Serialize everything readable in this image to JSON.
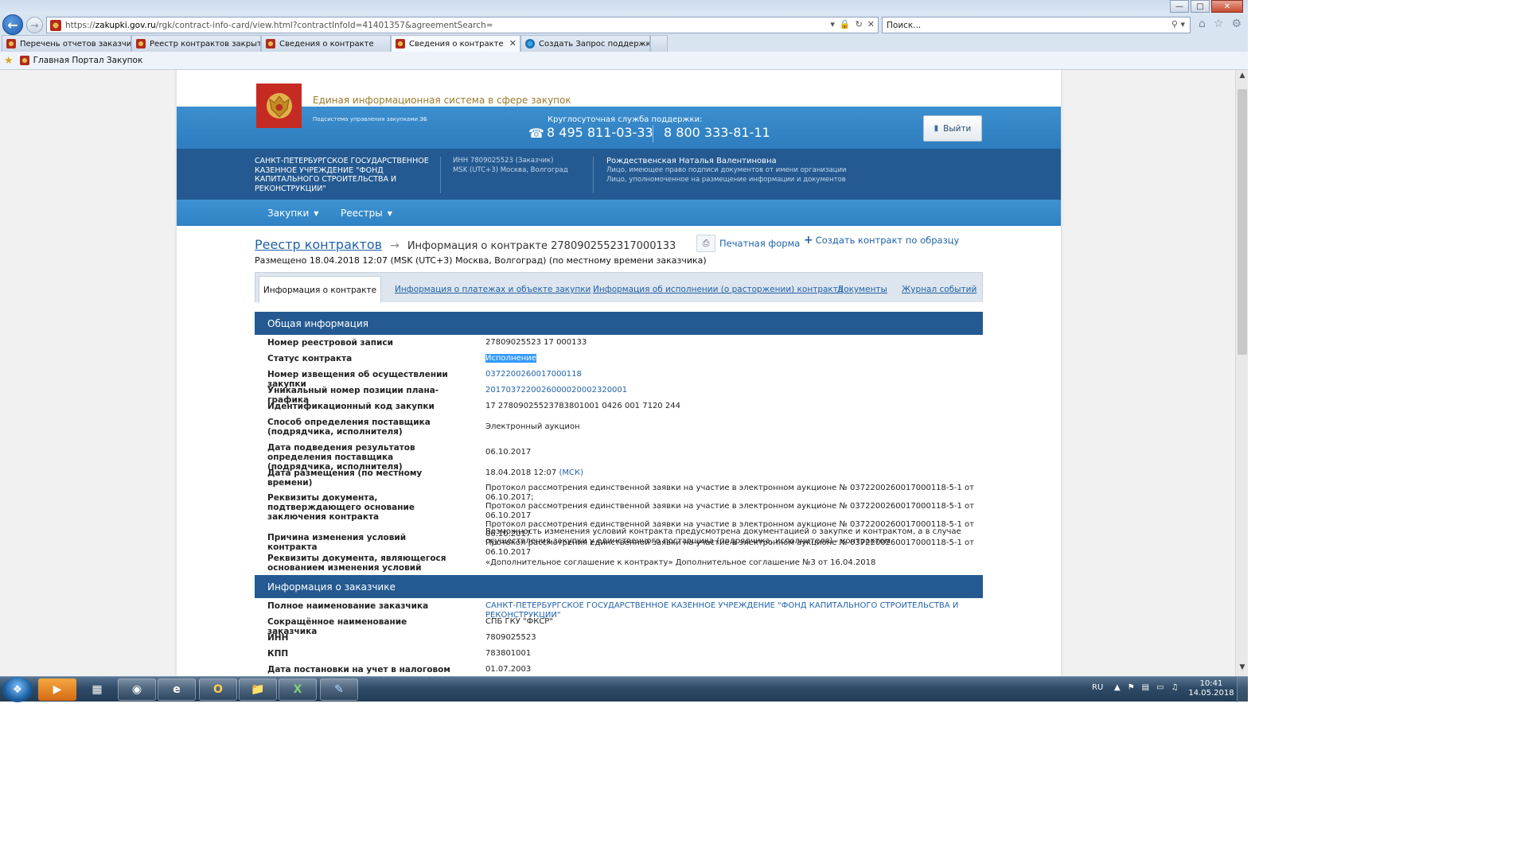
{
  "browser": {
    "url_prefix": "https://",
    "url_domain": "zakupki.gov.ru",
    "url_path": "/rgk/contract-info-card/view.html?contractInfoId=41401357&agreementSearch=",
    "search_placeholder": "Поиск...",
    "tabs": [
      {
        "label": "Перечень отчетов заказчика"
      },
      {
        "label": "Реестр контрактов закрытой ..."
      },
      {
        "label": "Сведения о контракте"
      },
      {
        "label": "Сведения о контракте"
      },
      {
        "label": "Создать Запрос поддержки - ..."
      }
    ],
    "favorites": [
      {
        "label": "Главная Портал Закупок"
      }
    ]
  },
  "header": {
    "site_title": "Единая информационная система в сфере закупок",
    "subsystem": "Подсистема управления закупками ЭБ",
    "support_label": "Круглосуточная служба поддержки:",
    "phone1": "8 495 811-03-33",
    "phone2": "8 800 333-81-11",
    "logout": "Выйти"
  },
  "org": {
    "name": "Санкт-Петербургское государственное казенное учреждение \"Фонд капитального строительства и реконструкции\"",
    "inn_line": "ИНН 7809025523 (Заказчик)",
    "tz_line": "MSK (UTC+3) Москва, Волгоград",
    "user_name": "Рождественская Наталья Валентиновна",
    "role1": "Лицо, имеющее право подписи документов от имени организации",
    "role2": "Лицо, уполномоченное на размещение информации и документов"
  },
  "menu": [
    "Закупки",
    "Реестры"
  ],
  "breadcrumb": {
    "registry": "Реестр контрактов",
    "current": "Информация о контракте 2780902552317000133"
  },
  "actions": {
    "print": "Печатная форма",
    "create": "Создать контракт по образцу"
  },
  "posted": "Размещено 18.04.2018 12:07 (MSK (UTC+3) Москва, Волгоград) (по местному времени заказчика)",
  "content_tabs": {
    "active": "Информация о контракте",
    "others": [
      "Информация о платежах и объекте закупки",
      "Информация об исполнении (о расторжении) контракта",
      "Документы",
      "Журнал событий"
    ]
  },
  "general": {
    "title": "Общая информация",
    "rows": [
      {
        "label": "Номер реестровой записи",
        "value": "27809025523 17 000133"
      },
      {
        "label": "Статус контракта",
        "value": "Исполнение"
      },
      {
        "label": "Номер извещения об осуществлении закупки",
        "value": "0372200260017000118"
      },
      {
        "label": "Уникальный номер позиции плана-графика",
        "value": "201703722002600002000232000​1"
      },
      {
        "label": "Идентификационный код закупки",
        "value": "17 27809025523783801001 0426 001 7120 244"
      },
      {
        "label": "Способ определения поставщика (подрядчика, исполнителя)",
        "value": "Электронный аукцион"
      },
      {
        "label": "Дата подведения результатов определения поставщика (подрядчика, исполнителя)",
        "value": "06.10.2017"
      },
      {
        "label": "Дата размещения (по местному времени)",
        "value": "18.04.2018 12:07",
        "value_suffix": "(МСК)"
      },
      {
        "label": "Реквизиты документа, подтверждающего основание заключения контракта",
        "value_lines": [
          "Протокол рассмотрения единственной заявки на участие в электронном аукционе № 0372200260017000118-5-1 от 06.10.2017;",
          "Протокол рассмотрения единственной заявки на участие в электронном аукционе № 0372200260017000118-5-1 от 06.10.2017",
          "Протокол рассмотрения единственной заявки на участие в электронном аукционе № 0372200260017000118-5-1 от 06.10.2017",
          "Протокол рассмотрения единственной заявки на участие в электронном аукционе № 0372200260017000118-5-1 от 06.10.2017"
        ]
      },
      {
        "label": "Причина изменения условий контракта",
        "value": "Возможность изменения условий контракта предусмотрена документацией о закупке и контрактом, а в случае осуществления закупки у единственного поставщика (подрядчика, исполнителя) - контрактом"
      },
      {
        "label": "Реквизиты документа, являющегося основанием изменения условий контракта",
        "value": "«Дополнительное соглашение к контракту» Дополнительное соглашение №3 от 16.04.2018"
      }
    ]
  },
  "customer": {
    "title": "Информация о заказчике",
    "rows": [
      {
        "label": "Полное наименование заказчика",
        "value": "САНКТ-ПЕТЕРБУРГСКОЕ ГОСУДАРСТВЕННОЕ КАЗЕННОЕ УЧРЕЖДЕНИЕ \"ФОНД КАПИТАЛЬНОГО СТРОИТЕЛЬСТВА И РЕКОНСТРУКЦИИ\""
      },
      {
        "label": "Сокращённое наименование заказчика",
        "value": "СПБ ГКУ \"ФКСР\""
      },
      {
        "label": "ИНН",
        "value": "7809025523"
      },
      {
        "label": "КПП",
        "value": "783801001"
      },
      {
        "label": "Дата постановки на учет в налоговом органе",
        "value": "01.07.2003"
      }
    ]
  },
  "taskbar": {
    "lang": "RU",
    "time": "10:41",
    "date": "14.05.2018"
  },
  "colors": {
    "header_blue": "#2d7dbf",
    "dark_blue": "#245a91",
    "link": "#1f62a8",
    "emblem_red": "#c62b23"
  }
}
